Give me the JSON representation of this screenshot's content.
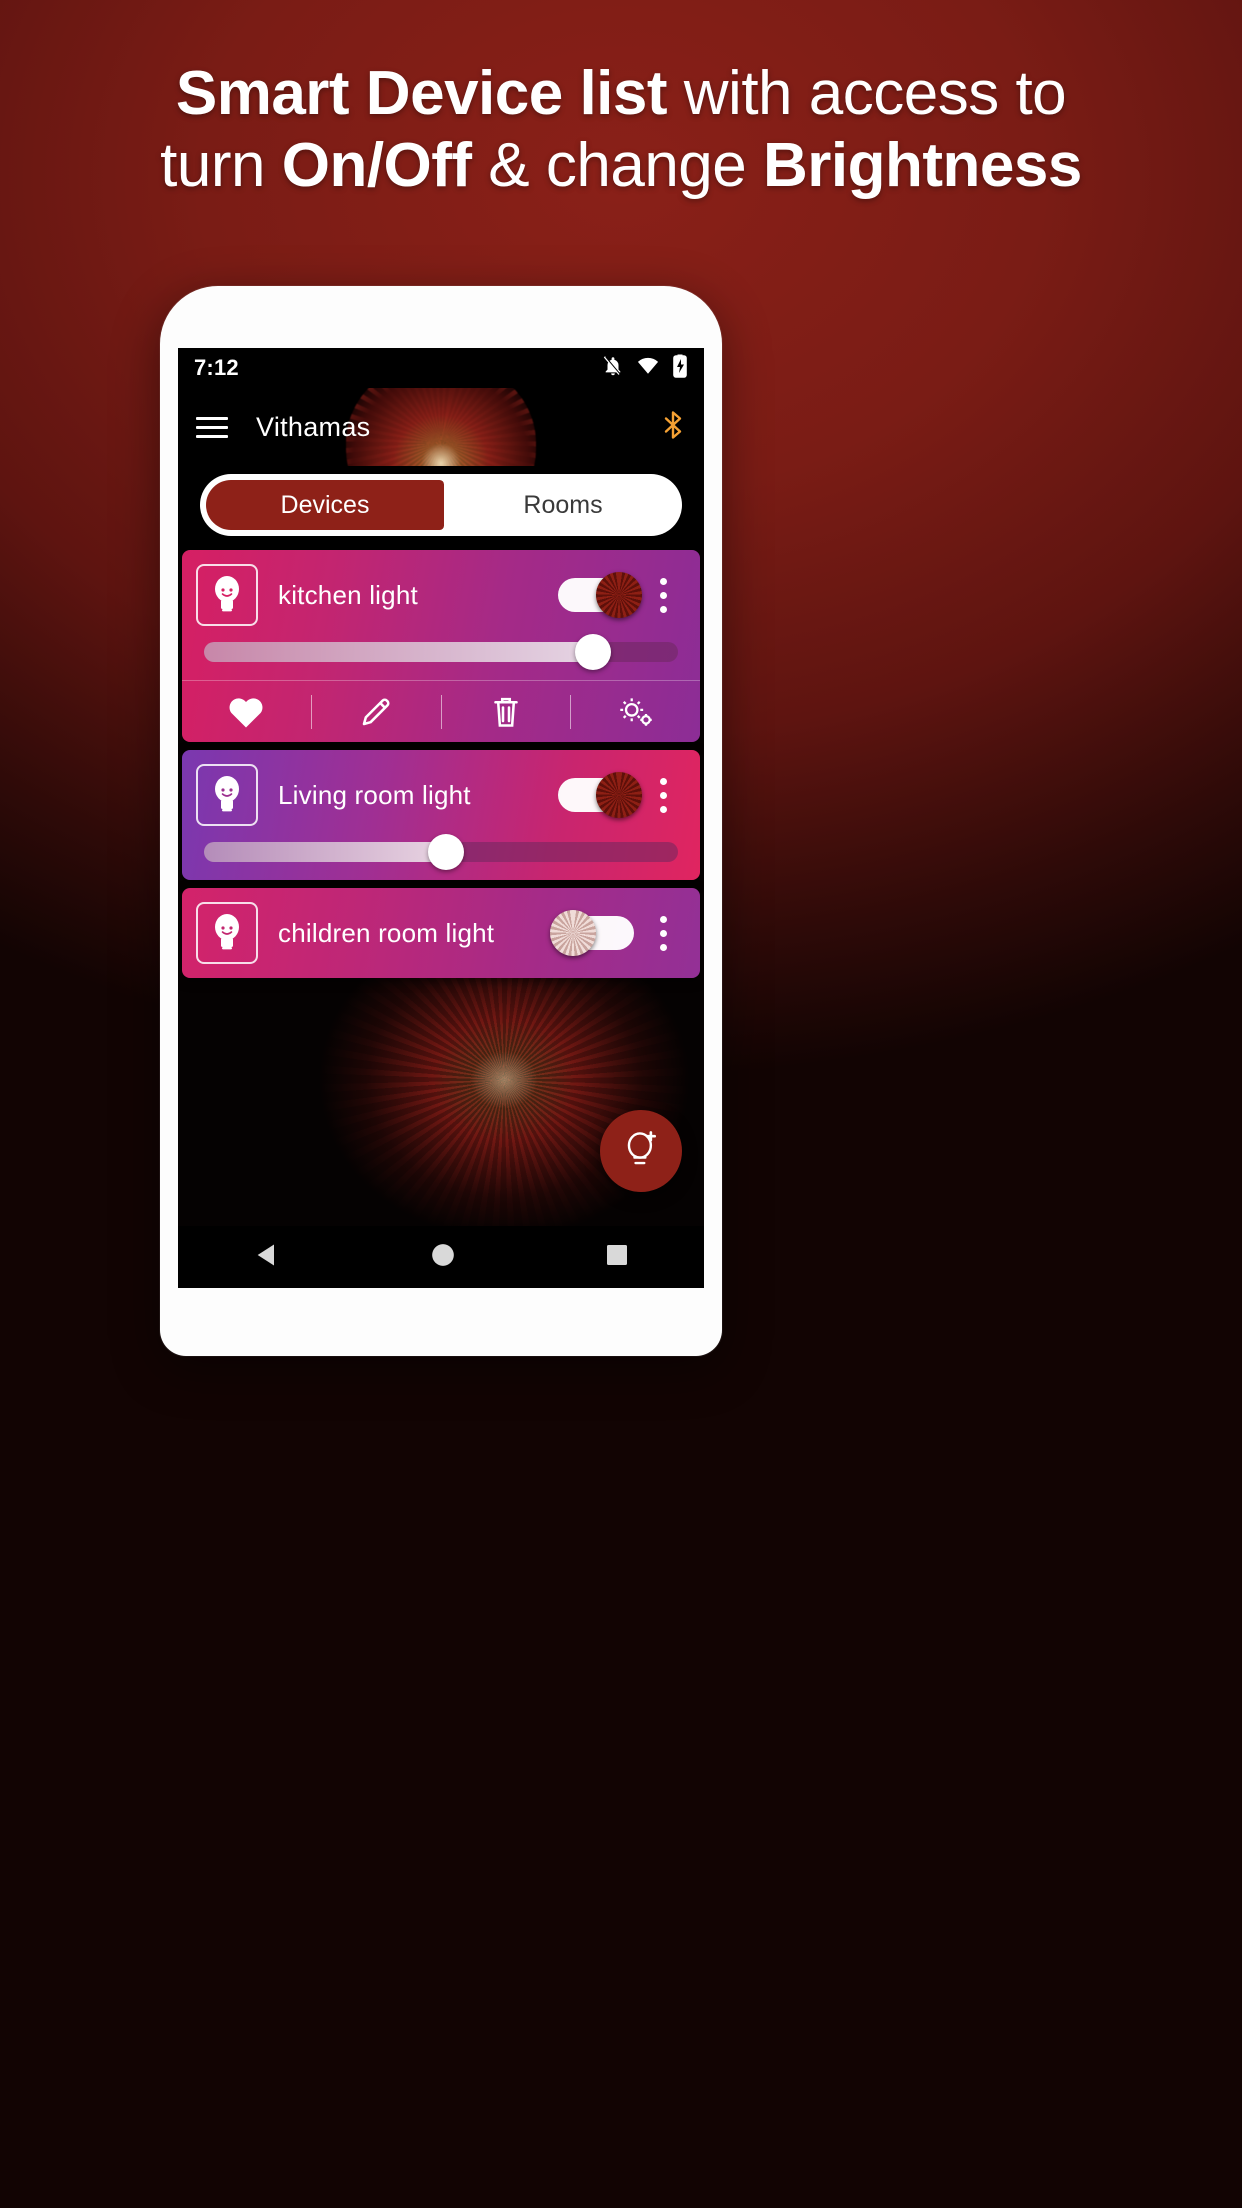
{
  "promo": {
    "line1_plain_a": "Smart Device list",
    "line1_plain_b": " with access to",
    "line2_a": "turn ",
    "line2_b": "On/Off",
    "line2_c": " & change ",
    "line2_d": "Brightness",
    "bg_color": "#7a1c15",
    "text_color": "#ffffff"
  },
  "status_bar": {
    "time": "7:12",
    "icons": [
      "bell-off-icon",
      "wifi-icon",
      "battery-charging-icon"
    ]
  },
  "app_bar": {
    "menu_icon": "hamburger-menu-icon",
    "title": "Vithamas",
    "bluetooth_icon": "bluetooth-icon",
    "bluetooth_color": "#f5a133"
  },
  "tabs": [
    {
      "label": "Devices",
      "active": true
    },
    {
      "label": "Rooms",
      "active": false
    }
  ],
  "devices": [
    {
      "name": "kitchen light",
      "icon": "light-bulb-icon",
      "toggle_state": "on",
      "toggle_label": "On",
      "brightness": 82,
      "expanded": true,
      "overflow_icon": "kebab-menu-icon",
      "actions": [
        {
          "name": "favorite-icon",
          "label": "Favorite"
        },
        {
          "name": "edit-pencil-icon",
          "label": "Edit"
        },
        {
          "name": "delete-trash-icon",
          "label": "Delete"
        },
        {
          "name": "settings-gear-icon",
          "label": "Settings"
        }
      ]
    },
    {
      "name": "Living room light",
      "icon": "light-bulb-icon",
      "toggle_state": "on",
      "toggle_label": "On",
      "brightness": 51,
      "expanded": false,
      "overflow_icon": "kebab-menu-icon"
    },
    {
      "name": "children room light",
      "icon": "light-bulb-icon",
      "toggle_state": "off",
      "toggle_label": "Off",
      "brightness": 0,
      "expanded": false,
      "has_slider": false,
      "overflow_icon": "kebab-menu-icon"
    }
  ],
  "fab": {
    "icon": "add-light-bulb-icon",
    "color": "#8e2118"
  },
  "nav_bar": {
    "back": "back-triangle-icon",
    "home": "home-circle-icon",
    "recents": "recents-square-icon"
  }
}
